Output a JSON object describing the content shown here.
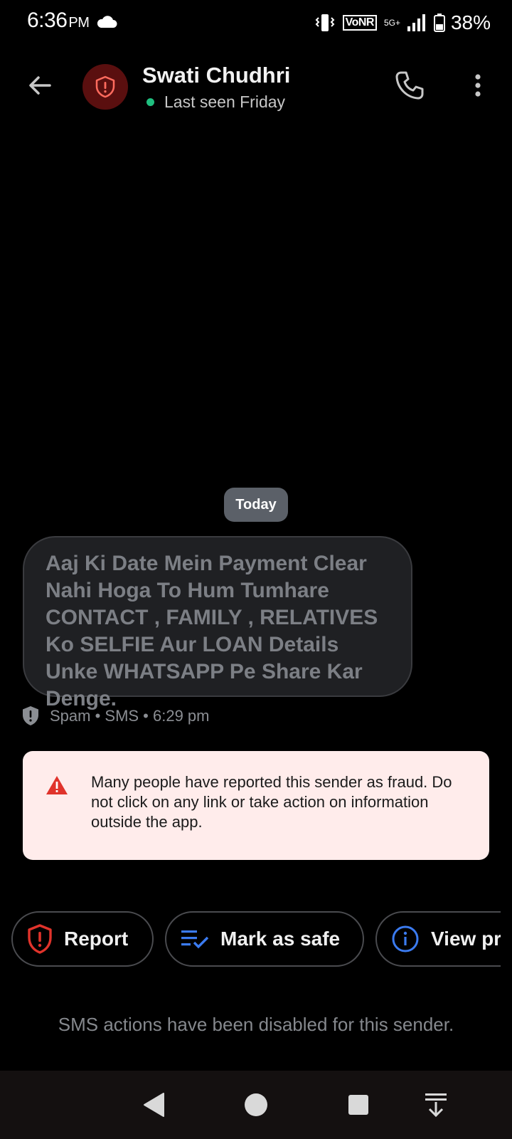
{
  "status_bar": {
    "time": "6:36",
    "ampm": "PM",
    "vonr": "VoNR",
    "network": "5G+",
    "battery": "38%"
  },
  "header": {
    "contact_name": "Swati Chudhri",
    "last_seen": "Last seen Friday"
  },
  "conversation": {
    "date_chip": "Today",
    "message": "Aaj Ki Date Mein Payment Clear Nahi Hoga To Hum Tumhare CONTACT , FAMILY , RELATIVES Ko SELFIE Aur LOAN Details Unke WHATSAPP Pe Share Kar Denge.",
    "meta": "Spam • SMS • 6:29 pm"
  },
  "warning": {
    "text": "Many people have reported this sender as fraud. Do not click on any link or take action on information outside the app."
  },
  "actions": {
    "report": "Report",
    "mark_safe": "Mark as safe",
    "view_profile": "View profile"
  },
  "footer": {
    "disabled_note": "SMS actions have been disabled for this sender."
  },
  "colors": {
    "background": "#000000",
    "avatar_bg": "#5a0f0f",
    "spam_red": "#e0332b",
    "safe_blue": "#3b7bf0",
    "online_green": "#1fbf7f",
    "warning_bg": "#ffeceb"
  },
  "icons": [
    "cloud-icon",
    "vibrate-icon",
    "signal-icon",
    "battery-icon",
    "back-arrow-icon",
    "shield-alert-icon",
    "phone-icon",
    "more-vertical-icon",
    "warning-triangle-icon",
    "checklist-icon",
    "info-icon"
  ]
}
